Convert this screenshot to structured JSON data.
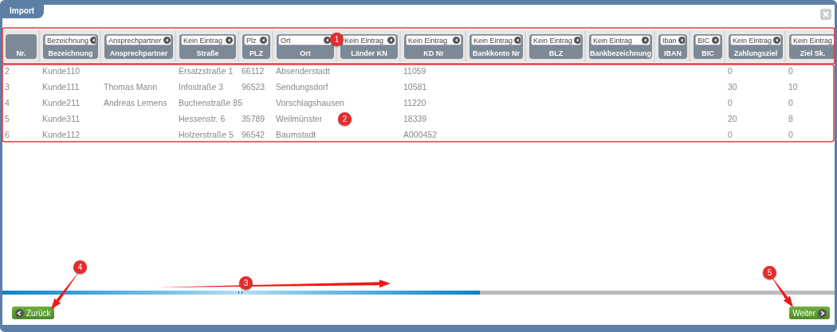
{
  "window": {
    "tab": "Import"
  },
  "table": {
    "columns": [
      {
        "label": "Nr."
      },
      {
        "mapping": "Bezeichnung",
        "label": "Bezeichnung"
      },
      {
        "mapping": "Ansprechpartner",
        "label": "Ansprechpartner"
      },
      {
        "mapping": "Kein Eintrag",
        "label": "Straße"
      },
      {
        "mapping": "Plz",
        "label": "PLZ"
      },
      {
        "mapping": "Ort",
        "label": "Ort"
      },
      {
        "mapping": "Kein Eintrag",
        "label": "Länder KN"
      },
      {
        "mapping": "Kein Eintrag",
        "label": "KD Nr"
      },
      {
        "mapping": "Kein Eintrag",
        "label": "Bankkonto Nr"
      },
      {
        "mapping": "Kein Eintrag",
        "label": "BLZ"
      },
      {
        "mapping": "Kein Eintrag",
        "label": "Bankbezeichnung"
      },
      {
        "mapping": "Iban",
        "label": "IBAN"
      },
      {
        "mapping": "BIC",
        "label": "BIC"
      },
      {
        "mapping": "Kein Eintrag",
        "label": "Zahlungsziel"
      },
      {
        "mapping": "Kein Eintrag",
        "label": "Ziel Sk."
      }
    ],
    "rows": [
      {
        "cells": [
          "2",
          "Kunde110",
          null,
          "Ersatzstraße 1",
          "66112",
          "Absenderstadt",
          null,
          "11059",
          null,
          null,
          null,
          null,
          null,
          "0",
          "0"
        ]
      },
      {
        "cells": [
          "3",
          "Kunde111",
          "Thomas Mann",
          "Infostraße 3",
          "96523",
          "Sendungsdorf",
          null,
          "10581",
          null,
          null,
          null,
          null,
          null,
          "30",
          "10"
        ]
      },
      {
        "cells": [
          "4",
          "Kunde211",
          "Andreas Lemens",
          "Buchenstraße 85",
          null,
          "Vorschlagshausen",
          null,
          "11220",
          null,
          null,
          null,
          null,
          null,
          "0",
          "0"
        ]
      },
      {
        "cells": [
          "5",
          "Kunde311",
          null,
          "Hessenstr. 6",
          "35789",
          "Weilmünster",
          null,
          "18339",
          null,
          null,
          null,
          null,
          null,
          "20",
          "8"
        ]
      },
      {
        "cells": [
          "6",
          "Kunde112",
          null,
          "Holzerstraße 5",
          "96542",
          "Baumstadt",
          null,
          "A000452",
          null,
          null,
          null,
          null,
          null,
          "0",
          "0"
        ]
      }
    ]
  },
  "buttons": [
    {
      "kind": "back",
      "label": "Zurück"
    },
    {
      "kind": "next",
      "label": "Weiter"
    }
  ],
  "annotations": [
    {
      "kind": "frame",
      "label": "1"
    },
    {
      "kind": "frame",
      "label": "2"
    },
    {
      "kind": "arrow",
      "label": "3"
    },
    {
      "kind": "arrow",
      "label": "4"
    },
    {
      "kind": "arrow",
      "label": "5"
    }
  ]
}
